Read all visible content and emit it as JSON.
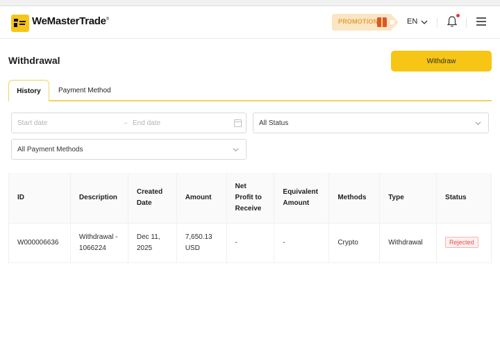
{
  "brand": {
    "name": "WeMasterTrade",
    "name_suffix": "®"
  },
  "header": {
    "promotion_label": "PROMOTION",
    "language": "EN",
    "icons": [
      "gift-icon",
      "chevron-down-icon",
      "bell-icon",
      "hamburger-menu-icon"
    ]
  },
  "page": {
    "title": "Withdrawal",
    "withdraw_button": "Withdraw"
  },
  "tabs": [
    {
      "label": "History",
      "active": true
    },
    {
      "label": "Payment Method",
      "active": false
    }
  ],
  "filters": {
    "start_placeholder": "Start date",
    "range_arrow": "→",
    "end_placeholder": "End date",
    "status_value": "All Status",
    "payment_method_value": "All Payment Methods"
  },
  "table": {
    "headers": [
      "ID",
      "Description",
      "Created Date",
      "Amount",
      "Net Profit to Receive",
      "Equivalent Amount",
      "Methods",
      "Type",
      "Status"
    ],
    "rows": [
      {
        "id": "W000006636",
        "description": "Withdrawal - 1066224",
        "created_date": "Dec 11, 2025",
        "amount": "7,650.13 USD",
        "net_profit": "-",
        "equivalent_amount": "-",
        "method": "Crypto",
        "type": "Withdrawal",
        "status": "Rejected"
      }
    ]
  },
  "colors": {
    "accent": "#f7c515",
    "status_rejected": "#e0524d",
    "promo_bg": "#fbe5c2"
  }
}
